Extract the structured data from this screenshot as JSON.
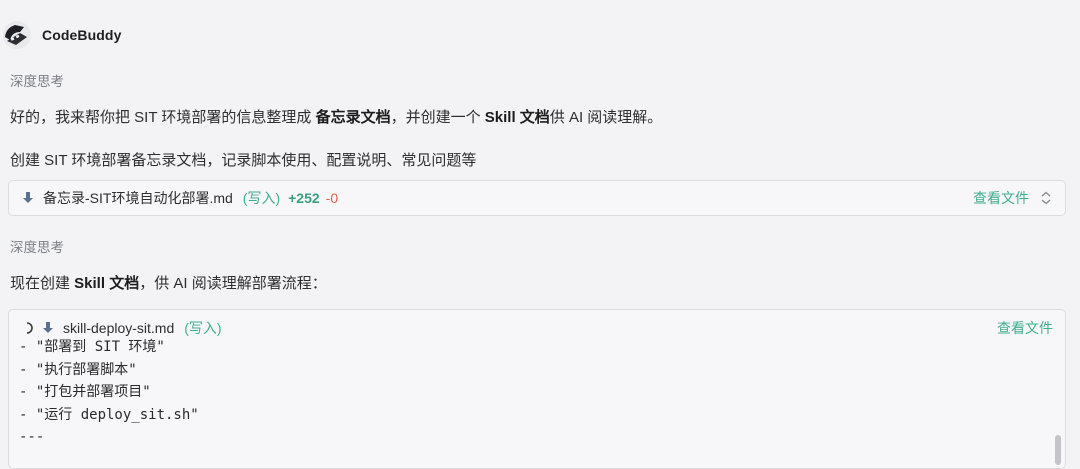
{
  "header": {
    "app_name": "CodeBuddy",
    "avatar_icon": "codebuddy-logo-icon"
  },
  "blocks": {
    "think1": "深度思考",
    "intro": {
      "part1": "好的，我来帮你把 SIT 环境部署的信息整理成 ",
      "bold1": "备忘录文档",
      "part2": "，并创建一个 ",
      "bold2": "Skill 文档",
      "part3": "供 AI 阅读理解。"
    },
    "step1": "创建 SIT 环境部署备忘录文档，记录脚本使用、配置说明、常见问题等",
    "file1": {
      "name": "备忘录-SIT环境自动化部署.md",
      "tag": "(写入)",
      "added": "+252",
      "removed": "-0",
      "view": "查看文件",
      "icon": "download-arrow-icon"
    },
    "think2": "深度思考",
    "step2": {
      "part1": "现在创建 ",
      "bold1": "Skill 文档",
      "part2": "，供 AI 阅读理解部署流程："
    },
    "file2": {
      "name": "skill-deploy-sit.md",
      "tag": "(写入)",
      "view": "查看文件",
      "code_lines": [
        "- \"部署到 SIT 环境\"",
        "- \"执行部署脚本\"",
        "- \"打包并部署项目\"",
        "- \"运行 deploy_sit.sh\"",
        "---"
      ]
    }
  },
  "colors": {
    "accent_green": "#3fae8f",
    "added_green": "#3aa07e",
    "removed_red": "#e0614e",
    "icon_blue": "#5b6f8f"
  }
}
